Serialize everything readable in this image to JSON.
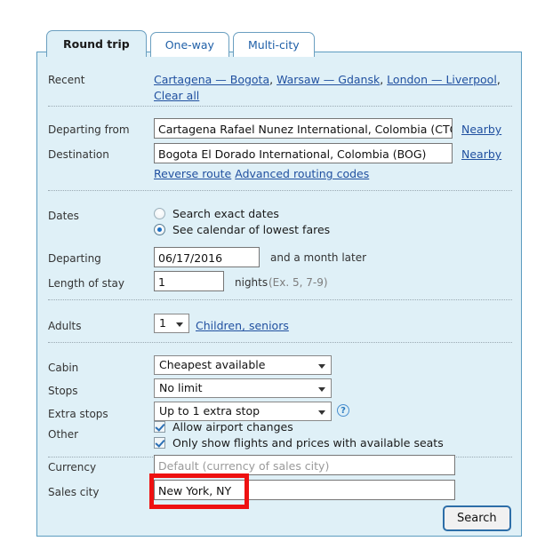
{
  "tabs": [
    {
      "label": "Round trip",
      "active": true
    },
    {
      "label": "One-way",
      "active": false
    },
    {
      "label": "Multi-city",
      "active": false
    }
  ],
  "recent": {
    "label": "Recent",
    "links": [
      "Cartagena — Bogota",
      "Warsaw — Gdansk",
      "London — Liverpool"
    ],
    "clear_all": "Clear all",
    "separator": ", "
  },
  "route": {
    "departing_from_label": "Departing from",
    "departing_from_value": "Cartagena Rafael Nunez International, Colombia (CTG)",
    "destination_label": "Destination",
    "destination_value": "Bogota El Dorado International, Colombia (BOG)",
    "nearby_label": "Nearby",
    "reverse_route_label": "Reverse route",
    "advanced_routing_label": "Advanced routing codes"
  },
  "dates": {
    "label": "Dates",
    "option_exact": "Search exact dates",
    "option_calendar": "See calendar of lowest fares",
    "selected_option": "calendar",
    "departing_label": "Departing",
    "departing_value": "06/17/2016",
    "and_month_later": "and a month later",
    "length_of_stay_label": "Length of stay",
    "length_of_stay_value": "1",
    "nights_label": "nights",
    "nights_hint": "(Ex. 5, 7-9)"
  },
  "passengers": {
    "adults_label": "Adults",
    "adults_value": "1",
    "children_seniors_link": "Children, seniors"
  },
  "options": {
    "cabin_label": "Cabin",
    "cabin_value": "Cheapest available",
    "stops_label": "Stops",
    "stops_value": "No limit",
    "extra_stops_label": "Extra stops",
    "extra_stops_value": "Up to 1 extra stop",
    "help_icon_glyph": "?",
    "other_label": "Other",
    "allow_airport_changes": "Allow airport changes",
    "allow_airport_changes_checked": true,
    "only_available_seats": "Only show flights and prices with available seats",
    "only_available_seats_checked": true
  },
  "sales": {
    "currency_label": "Currency",
    "currency_placeholder": "Default (currency of sales city)",
    "currency_value": "",
    "sales_city_label": "Sales city",
    "sales_city_value": "New York, NY"
  },
  "actions": {
    "search_label": "Search"
  },
  "colors": {
    "panel_bg": "#dff0f7",
    "panel_border": "#5c9cc0",
    "link": "#2050a0",
    "annotation": "#ee1111",
    "accent_blue": "#2a7ac0"
  }
}
